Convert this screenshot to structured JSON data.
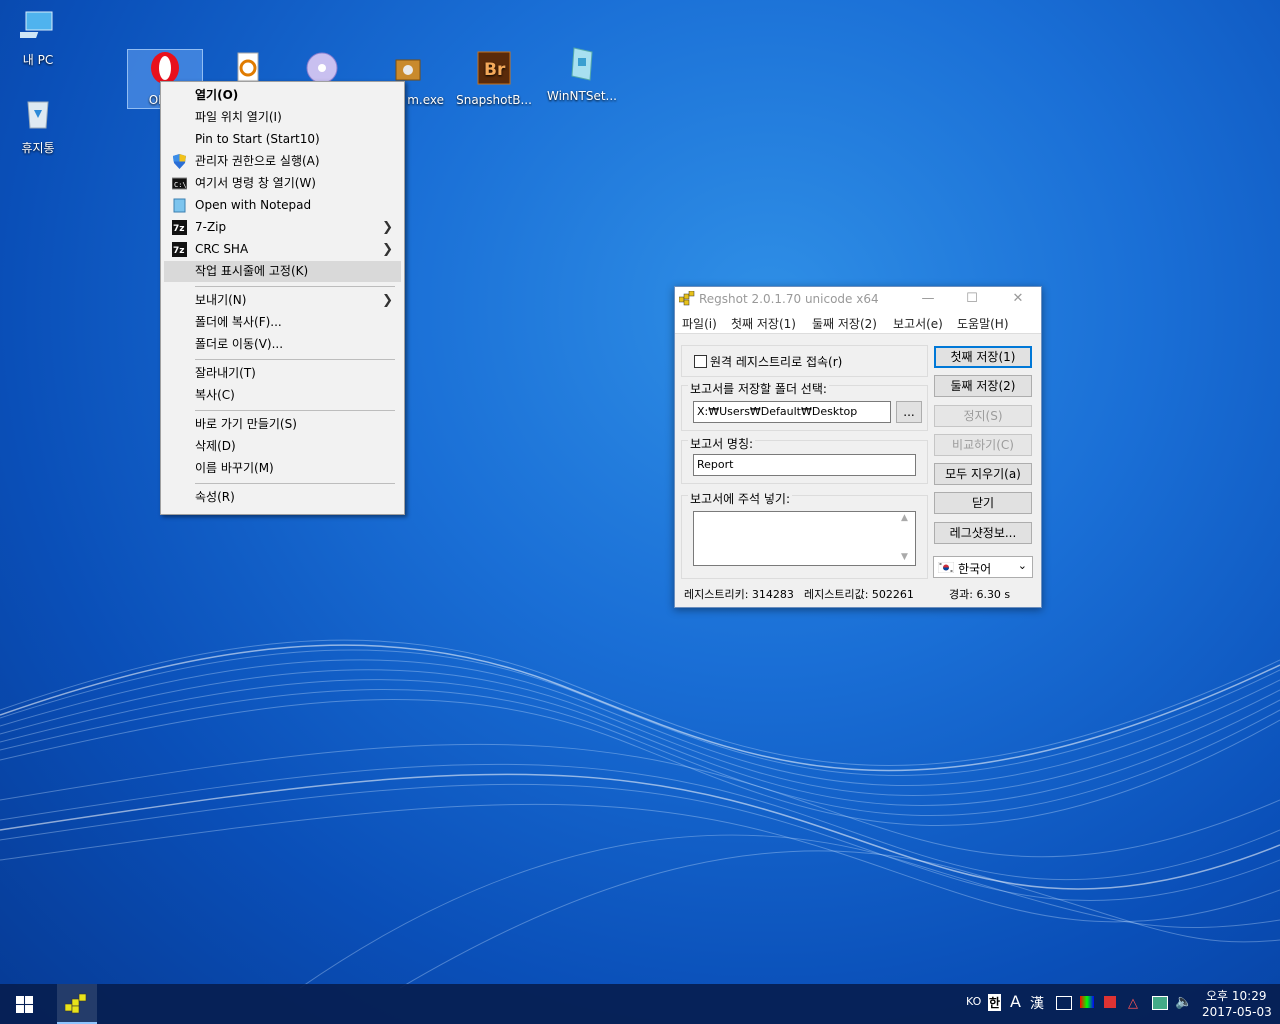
{
  "desktop": {
    "icons": [
      {
        "label": "내 PC",
        "icon": "computer-icon"
      },
      {
        "label": "휴지통",
        "icon": "recycle-bin-icon"
      },
      {
        "label": "OPER",
        "icon": "opera-icon"
      },
      {
        "label": "",
        "icon": "file-tool-icon"
      },
      {
        "label": "",
        "icon": "disc-icon"
      },
      {
        "label": "m.exe",
        "icon": "package-icon"
      },
      {
        "label": "SnapshotB...",
        "icon": "bridge-icon"
      },
      {
        "label": "WinNTSet...",
        "icon": "setup-icon"
      }
    ]
  },
  "context_menu": {
    "items": [
      {
        "label": "열기(O)"
      },
      {
        "label": "파일 위치 열기(I)"
      },
      {
        "label": "Pin to Start (Start10)"
      },
      {
        "label": "관리자 권한으로 실행(A)",
        "icon": "shield-icon"
      },
      {
        "label": "여기서 명령 창 열기(W)",
        "icon": "cmd-icon"
      },
      {
        "label": "Open with Notepad",
        "icon": "notepad-icon"
      },
      {
        "label": "7-Zip",
        "icon": "7zip-icon"
      },
      {
        "label": "CRC SHA",
        "icon": "7zip-icon"
      },
      {
        "label": "작업 표시줄에 고정(K)"
      },
      {
        "label": "보내기(N)"
      },
      {
        "label": "폴더에 복사(F)..."
      },
      {
        "label": "폴더로 이동(V)..."
      },
      {
        "label": "잘라내기(T)"
      },
      {
        "label": "복사(C)"
      },
      {
        "label": "바로 가기 만들기(S)"
      },
      {
        "label": "삭제(D)"
      },
      {
        "label": "이름 바꾸기(M)"
      },
      {
        "label": "속성(R)"
      }
    ]
  },
  "regshot": {
    "title": "Regshot 2.0.1.70 unicode x64",
    "menu": [
      "파일(i)",
      "첫째 저장(1)",
      "둘째 저장(2)",
      "보고서(e)",
      "도움말(H)"
    ],
    "remote_checkbox": "원격 레지스트리로 접속(r)",
    "remote_checked": false,
    "folder_label": "보고서를 저장할 폴더 선택:",
    "folder_value": "X:₩Users₩Default₩Desktop",
    "browse_label": "...",
    "report_name_label": "보고서 명칭:",
    "report_name_value": "Report",
    "comment_label": "보고서에 주석 넣기:",
    "comment_value": "",
    "buttons": {
      "first_shot": "첫째 저장(1)",
      "second_shot": "둘째 저장(2)",
      "stop": "정지(S)",
      "compare": "비교하기(C)",
      "clear_all": "모두 지우기(a)",
      "close": "닫기",
      "about": "레그샷정보..."
    },
    "language": "한국어",
    "status": {
      "keys": "레지스트리키: 314283",
      "values": "레지스트리값: 502261",
      "elapsed": "경과: 6.30 s"
    }
  },
  "taskbar": {
    "ime": "KO",
    "ime_mode": "한",
    "ime_a": "A",
    "ime_hanja": "漢",
    "clock_time": "오후 10:29",
    "clock_date": "2017-05-03"
  }
}
